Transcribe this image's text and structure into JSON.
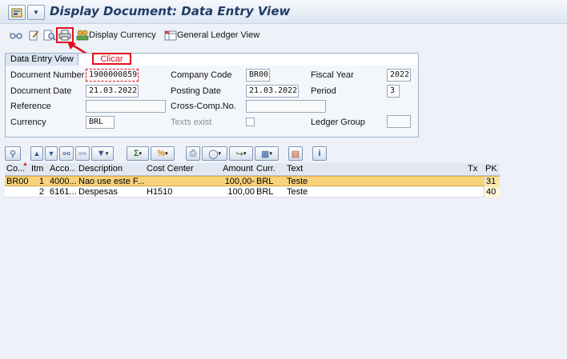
{
  "window": {
    "title": "Display Document: Data Entry View"
  },
  "toolbar": {
    "display_currency_label": "Display Currency",
    "general_ledger_label": "General Ledger View"
  },
  "annotation": {
    "callout_text": "Clicar",
    "highlight_color": "#e1111d"
  },
  "panel": {
    "tab_label": "Data Entry View",
    "fields": {
      "document_number": {
        "label": "Document Number",
        "value": "1900000859"
      },
      "company_code": {
        "label": "Company Code",
        "value": "BR00"
      },
      "fiscal_year": {
        "label": "Fiscal Year",
        "value": "2022"
      },
      "document_date": {
        "label": "Document Date",
        "value": "21.03.2022"
      },
      "posting_date": {
        "label": "Posting Date",
        "value": "21.03.2022"
      },
      "period": {
        "label": "Period",
        "value": "3"
      },
      "reference": {
        "label": "Reference",
        "value": ""
      },
      "cross_comp": {
        "label": "Cross-Comp.No.",
        "value": ""
      },
      "currency": {
        "label": "Currency",
        "value": "BRL"
      },
      "texts_exist": {
        "label": "Texts exist"
      },
      "ledger_group": {
        "label": "Ledger Group",
        "value": ""
      }
    }
  },
  "table": {
    "headers": {
      "co": "Co...",
      "itm": "Itm",
      "acco": "Acco...",
      "description": "Description",
      "cost_center": "Cost Center",
      "amount": "Amount",
      "curr": "Curr.",
      "text": "Text",
      "tx": "Tx",
      "pk": "PK"
    },
    "rows": [
      {
        "co": "BR00",
        "itm": "1",
        "acco": "4000...",
        "description": "Nao use este F...",
        "cost_center": "",
        "amount": "100,00-",
        "curr": "BRL",
        "text": "Teste",
        "tx": "",
        "pk": "31"
      },
      {
        "co": "",
        "itm": "2",
        "acco": "6161...",
        "description": "Despesas",
        "cost_center": "H1510",
        "amount": "100,00",
        "curr": "BRL",
        "text": "Teste",
        "tx": "",
        "pk": "40"
      }
    ]
  },
  "colors": {
    "selected_row": "#f9d37c",
    "title_text": "#1f3d67"
  }
}
